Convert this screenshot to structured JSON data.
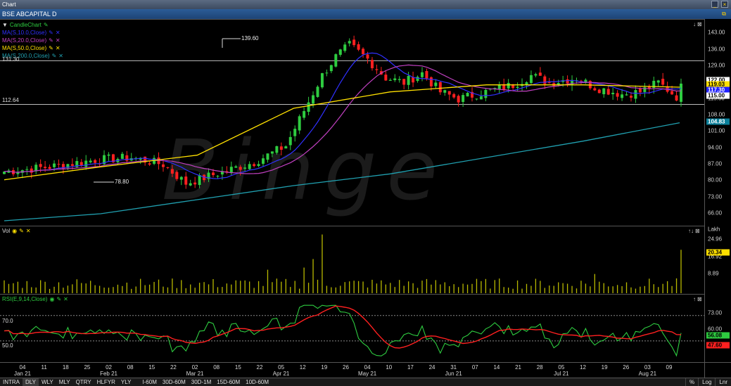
{
  "window": {
    "title": "Chart"
  },
  "header": {
    "title": "BSE ABCAPITAL D"
  },
  "watermark": "Binge",
  "price_pane": {
    "legend": [
      {
        "label": "CandleChart",
        "color": "#2ecc40",
        "icon": "pencil-icon"
      },
      {
        "label": "MA(S,10.0,Close)",
        "color": "#3030ff",
        "icon": "pencil-icon"
      },
      {
        "label": "MA(S,20.0,Close)",
        "color": "#c040c0",
        "icon": "pencil-icon"
      },
      {
        "label": "MA(S,50.0,Close)",
        "color": "#ffe000",
        "icon": "pencil-icon"
      },
      {
        "label": "MA(S,200.0,Close)",
        "color": "#20a0b0",
        "icon": "pencil-icon"
      }
    ],
    "hline_labels": {
      "upper": "131.30",
      "lower": "112.64"
    },
    "annotations": {
      "high": "139.60",
      "low": "78.80"
    },
    "axis_ticks": [
      "143.00",
      "136.00",
      "129.00",
      "122.00",
      "115.00",
      "108.00",
      "101.00",
      "94.00",
      "87.00",
      "80.00",
      "73.00",
      "66.00"
    ],
    "tags": [
      {
        "label": "122.00",
        "bg": "#ffffff",
        "fg": "#000000"
      },
      {
        "label": "119.03",
        "bg": "#ffe000",
        "fg": "#000000"
      },
      {
        "label": "117.30",
        "bg": "#2020ff",
        "fg": "#ffffff"
      },
      {
        "label": "115.00",
        "bg": "#ffffff",
        "fg": "#000000"
      },
      {
        "label": "104.83",
        "bg": "#0a7f9a",
        "fg": "#ffffff"
      }
    ]
  },
  "volume_pane": {
    "label": "Vol",
    "unit": "Lakh",
    "axis_ticks": [
      "24.96",
      "16.92",
      "8.89"
    ],
    "tag": {
      "label": "20.34",
      "bg": "#ffe000",
      "fg": "#000000"
    }
  },
  "rsi_pane": {
    "label": "RSI(E,9,14,Close)",
    "axis_ticks": [
      "73.00",
      "60.00"
    ],
    "level_labels": {
      "high": "70.0",
      "low": "50.0"
    },
    "tags": [
      {
        "label": "56.08",
        "bg": "#2ecc40",
        "fg": "#000000"
      },
      {
        "label": "47.60",
        "bg": "#ff2020",
        "fg": "#000000"
      }
    ]
  },
  "date_axis": [
    {
      "day": "04",
      "month": "Jan 21"
    },
    {
      "day": "11",
      "month": ""
    },
    {
      "day": "18",
      "month": ""
    },
    {
      "day": "25",
      "month": ""
    },
    {
      "day": "02",
      "month": "Feb 21"
    },
    {
      "day": "08",
      "month": ""
    },
    {
      "day": "15",
      "month": ""
    },
    {
      "day": "22",
      "month": ""
    },
    {
      "day": "02",
      "month": "Mar 21"
    },
    {
      "day": "08",
      "month": ""
    },
    {
      "day": "15",
      "month": ""
    },
    {
      "day": "22",
      "month": ""
    },
    {
      "day": "05",
      "month": "Apr 21"
    },
    {
      "day": "12",
      "month": ""
    },
    {
      "day": "19",
      "month": ""
    },
    {
      "day": "26",
      "month": ""
    },
    {
      "day": "04",
      "month": "May 21"
    },
    {
      "day": "10",
      "month": ""
    },
    {
      "day": "17",
      "month": ""
    },
    {
      "day": "24",
      "month": ""
    },
    {
      "day": "31",
      "month": "Jun 21"
    },
    {
      "day": "07",
      "month": ""
    },
    {
      "day": "14",
      "month": ""
    },
    {
      "day": "21",
      "month": ""
    },
    {
      "day": "28",
      "month": ""
    },
    {
      "day": "05",
      "month": "Jul 21"
    },
    {
      "day": "12",
      "month": ""
    },
    {
      "day": "19",
      "month": ""
    },
    {
      "day": "26",
      "month": ""
    },
    {
      "day": "03",
      "month": "Aug 21"
    },
    {
      "day": "09",
      "month": ""
    }
  ],
  "timeframes": [
    "INTRA",
    "DLY",
    "WLY",
    "MLY",
    "QTRY",
    "HLFYR",
    "YLY"
  ],
  "intraday": [
    "I-60M",
    "30D-60M",
    "30D-1M",
    "15D-60M",
    "10D-60M"
  ],
  "selected_timeframe": "DLY",
  "status_right": [
    "%",
    "Log",
    "Lnr"
  ],
  "chart_data": {
    "type": "line",
    "title": "BSE ABCAPITAL D",
    "ylim": [
      62,
      146
    ],
    "x_range": [
      "Jan 21",
      "Aug 21"
    ],
    "series": [
      {
        "name": "MA(S,50.0,Close)",
        "x": [
          "Jan 21",
          "Feb 21",
          "Mar 21",
          "Apr 21",
          "May 21",
          "Jun 21",
          "Jul 21",
          "Aug 21"
        ],
        "values": [
          80.5,
          86,
          91,
          111,
          118,
          121,
          121,
          120
        ]
      },
      {
        "name": "MA(S,200.0,Close)",
        "x": [
          "Jan 21",
          "Feb 21",
          "Mar 21",
          "Apr 21",
          "May 21",
          "Jun 21",
          "Jul 21",
          "Aug 21"
        ],
        "values": [
          63,
          66,
          72,
          78,
          83,
          90,
          97,
          104.83
        ]
      }
    ],
    "annotations": [
      "139.60",
      "78.80"
    ]
  }
}
